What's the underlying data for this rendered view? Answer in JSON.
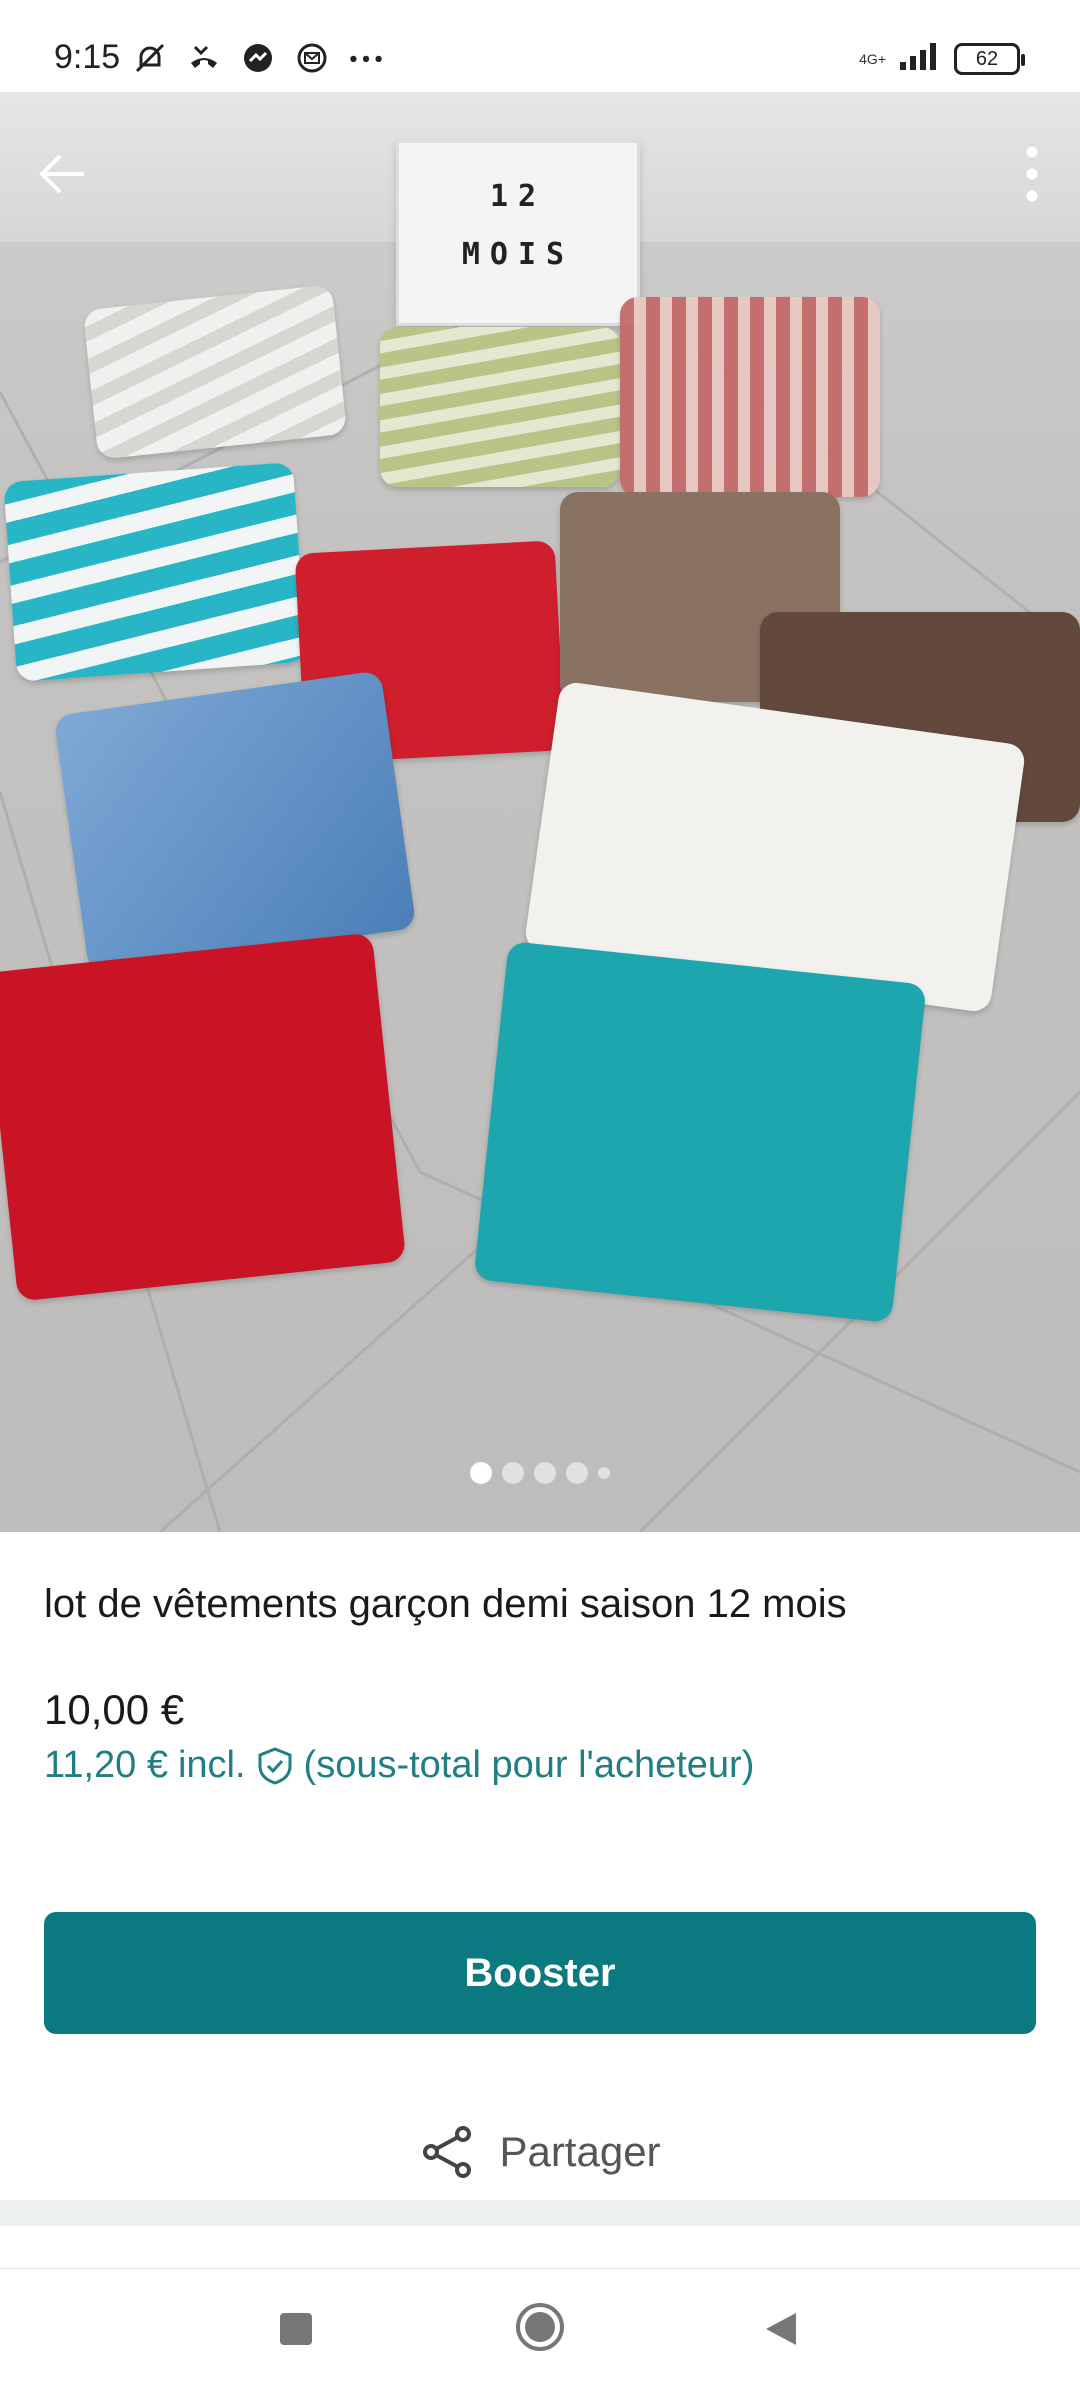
{
  "status_bar": {
    "time": "9:15",
    "network": "4G+",
    "battery": "62",
    "icons": [
      "mute-icon",
      "missed-call-icon",
      "messenger-icon",
      "mail-icon",
      "more-dots-icon",
      "signal-icon",
      "battery-icon"
    ]
  },
  "photo": {
    "sign_line1": "12",
    "sign_line2": "MOIS",
    "page_count": 5,
    "active_page": 1
  },
  "listing": {
    "title": "lot de vêtements garçon demi saison 12 mois",
    "price": "10,00 €",
    "buyer_price": "11,20 €",
    "buyer_incl": "incl.",
    "buyer_note": "(sous-total pour l'acheteur)"
  },
  "actions": {
    "booster": "Booster",
    "share": "Partager"
  },
  "colors": {
    "accent": "#0a7a80",
    "buyer_text": "#1f7f83"
  }
}
